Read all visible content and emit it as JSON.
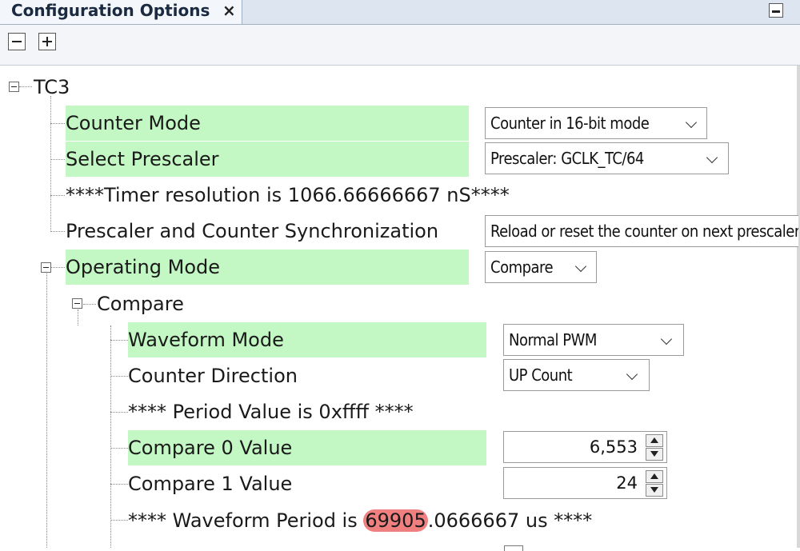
{
  "tab": {
    "title": "Configuration Options",
    "close": "×"
  },
  "tree": {
    "root": "TC3",
    "counter_mode": {
      "label": "Counter Mode",
      "value": "Counter in 16-bit mode"
    },
    "select_prescaler": {
      "label": "Select Prescaler",
      "value": "Prescaler: GCLK_TC/64"
    },
    "timer_resolution": "****Timer resolution is 1066.66666667 nS****",
    "prescaler_sync": {
      "label": "Prescaler and Counter Synchronization",
      "value": "Reload or reset the counter on next prescaler clock"
    },
    "operating_mode": {
      "label": "Operating Mode",
      "value": "Compare"
    },
    "compare_node": "Compare",
    "waveform_mode": {
      "label": "Waveform Mode",
      "value": "Normal PWM"
    },
    "counter_direction": {
      "label": "Counter Direction",
      "value": "UP Count"
    },
    "period_value": "**** Period Value is 0xffff ****",
    "compare0": {
      "label": "Compare 0 Value",
      "value": "6,553"
    },
    "compare1": {
      "label": "Compare 1 Value",
      "value": "24"
    },
    "waveform_period": {
      "prefix": "**** Waveform Period is ",
      "highlight": "69905",
      "suffix": ".0666667 us ****"
    }
  },
  "colors": {
    "row_highlight": "#c3f7c3",
    "value_mark": "#f08080"
  }
}
